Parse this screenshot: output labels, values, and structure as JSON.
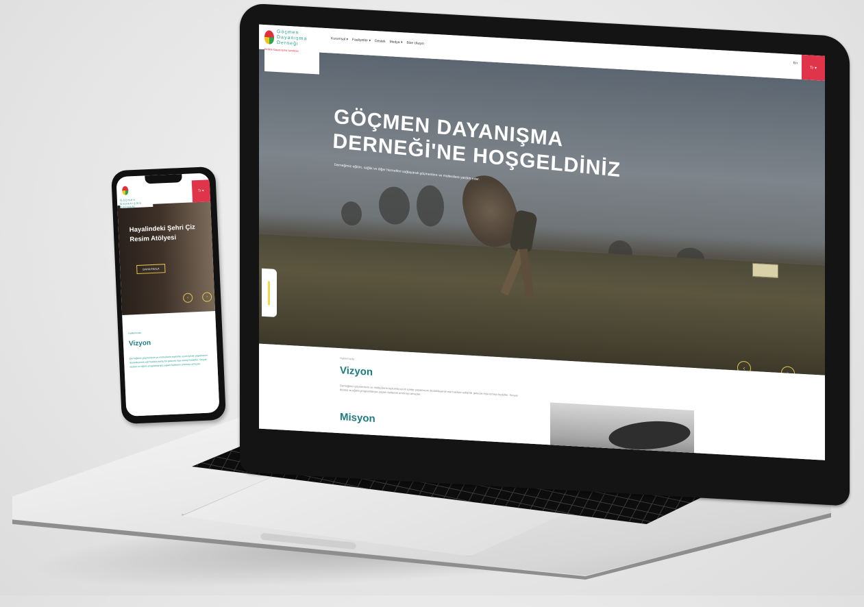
{
  "laptop": {
    "logo": {
      "name_line1": "Göçmen",
      "name_line2": "Dayanışma",
      "name_line3": "Derneği",
      "tagline": "Birlikte Dayanışma İçindeyiz"
    },
    "nav": {
      "items": [
        "Kurumsal ▾",
        "Faaliyetler ▾",
        "Destek",
        "Medya ▾",
        "Bize Ulaşın"
      ],
      "lang": "En",
      "lang_button": "Tr ▾"
    },
    "hero": {
      "title_line1": "GÖÇMEN DAYANIŞMA",
      "title_line2": "DERNEĞİ'NE HOŞGELDİNİZ",
      "subtitle": "Derneğimiz eğitim, sağlık ve diğer hizmetleri sağlayarak göçmenlere ve mültecilere yardım eder.",
      "prev": "‹",
      "next": "›"
    },
    "content": {
      "breadcrumb": "Hakkımızda",
      "vision_heading": "Vizyon",
      "vision_text": "Derneğimiz göçmenlerin ve mültecilerin toplumla uyum içinde yaşamasını destekleyerek eşit haklara sahip bir gelecek inşa etmeyi hedefler. Sosyal destek ve eğitim programlarıyla yaşam kalitesini artırmayı amaçlar.",
      "mission_heading": "Misyon"
    }
  },
  "phone": {
    "lang_button": "Tr ▾",
    "hero": {
      "title": "Hayalindeki Şehri Çiz Resim Atölyesi",
      "button": "DAHA FAZLA",
      "prev": "‹",
      "next": "›"
    },
    "content": {
      "breadcrumb": "Hakkımızda",
      "vision_heading": "Vizyon",
      "vision_text": "Derneğimiz göçmenlerin ve mültecilerin toplumla uyum içinde yaşamasını destekleyerek eşit haklara sahip bir gelecek inşa etmeyi hedefler. Sosyal destek ve eğitim programlarıyla yaşam kalitesini artırmayı amaçlar."
    }
  },
  "colors": {
    "brand_red": "#e0344a",
    "brand_teal": "#1e7c80",
    "accent_yellow": "#e8c84a"
  }
}
